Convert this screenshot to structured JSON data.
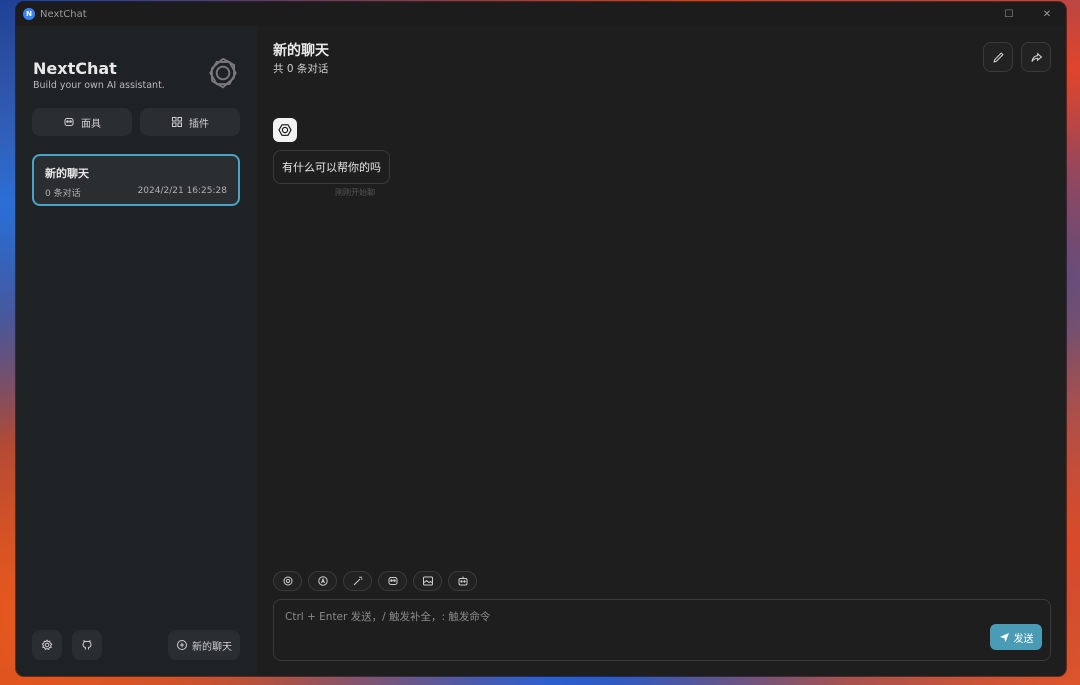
{
  "window": {
    "title": "NextChat",
    "app_icon_letter": "N",
    "maximize": "☐",
    "close": "✕"
  },
  "sidebar": {
    "brand_title": "NextChat",
    "brand_subtitle": "Build your own AI assistant.",
    "mask_label": "面具",
    "plugin_label": "插件",
    "chat_item": {
      "title": "新的聊天",
      "count": "0 条对话",
      "time": "2024/2/21 16:25:28"
    },
    "new_chat_label": "新的聊天"
  },
  "main": {
    "title": "新的聊天",
    "subtitle": "共 0 条对话",
    "message": "有什么可以帮你的吗",
    "message_status": "刚刚开始聊",
    "input_placeholder": "Ctrl + Enter 发送，/ 触发补全，: 触发命令",
    "send_label": "发送"
  },
  "colors": {
    "accent": "#4aa3c4",
    "send": "#4a9bb5",
    "sidebar": "#1f2225",
    "main": "#1e1e1e"
  }
}
